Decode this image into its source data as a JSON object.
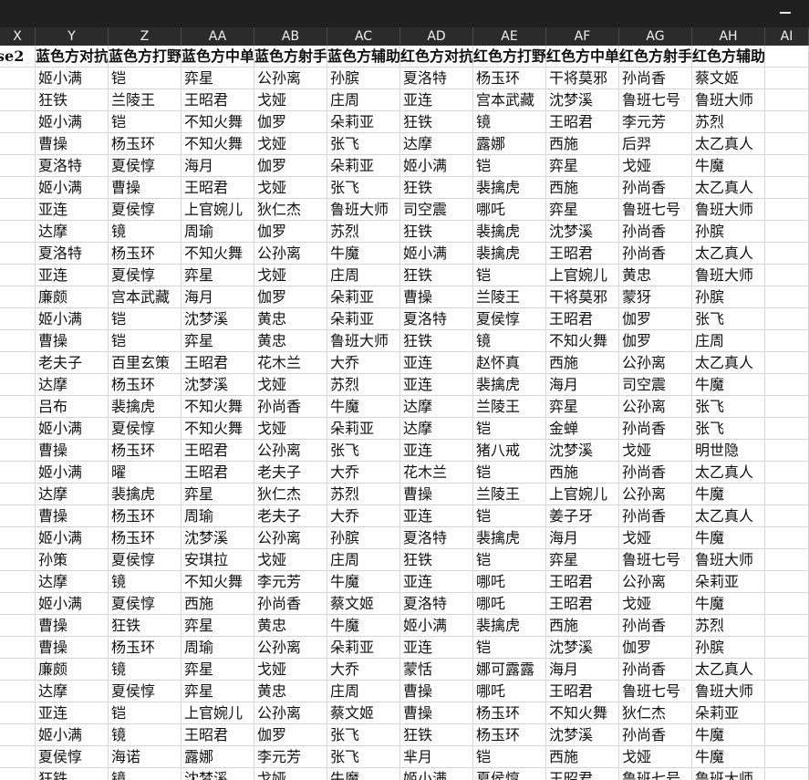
{
  "columns": [
    "X",
    "Y",
    "Z",
    "AA",
    "AB",
    "AC",
    "AD",
    "AE",
    "AF",
    "AG",
    "AH",
    "AI"
  ],
  "header": [
    "se2",
    "蓝色方对抗",
    "蓝色方打野",
    "蓝色方中单",
    "蓝色方射手",
    "蓝色方辅助",
    "红色方对抗",
    "红色方打野",
    "红色方中单",
    "红色方射手",
    "红色方辅助",
    ""
  ],
  "rows": [
    [
      "",
      "姬小满",
      "铠",
      "弈星",
      "公孙离",
      "孙膑",
      "夏洛特",
      "杨玉环",
      "干将莫邪",
      "孙尚香",
      "蔡文姬",
      ""
    ],
    [
      "",
      "狂铁",
      "兰陵王",
      "王昭君",
      "戈娅",
      "庄周",
      "亚连",
      "宫本武藏",
      "沈梦溪",
      "鲁班七号",
      "鲁班大师",
      ""
    ],
    [
      "",
      "姬小满",
      "铠",
      "不知火舞",
      "伽罗",
      "朵莉亚",
      "狂铁",
      "镜",
      "王昭君",
      "李元芳",
      "苏烈",
      ""
    ],
    [
      "",
      "曹操",
      "杨玉环",
      "不知火舞",
      "戈娅",
      "张飞",
      "达摩",
      "露娜",
      "西施",
      "后羿",
      "太乙真人",
      ""
    ],
    [
      "",
      "夏洛特",
      "夏侯惇",
      "海月",
      "伽罗",
      "朵莉亚",
      "姬小满",
      "铠",
      "弈星",
      "戈娅",
      "牛魔",
      ""
    ],
    [
      "",
      "姬小满",
      "曹操",
      "王昭君",
      "戈娅",
      "张飞",
      "狂铁",
      "裴擒虎",
      "西施",
      "孙尚香",
      "太乙真人",
      ""
    ],
    [
      "",
      "亚连",
      "夏侯惇",
      "上官婉儿",
      "狄仁杰",
      "鲁班大师",
      "司空震",
      "哪吒",
      "弈星",
      "鲁班七号",
      "鲁班大师",
      ""
    ],
    [
      "",
      "达摩",
      "镜",
      "周瑜",
      "伽罗",
      "苏烈",
      "狂铁",
      "裴擒虎",
      "沈梦溪",
      "孙尚香",
      "孙膑",
      ""
    ],
    [
      "",
      "夏洛特",
      "杨玉环",
      "不知火舞",
      "公孙离",
      "牛魔",
      "姬小满",
      "裴擒虎",
      "王昭君",
      "孙尚香",
      "太乙真人",
      ""
    ],
    [
      "",
      "亚连",
      "夏侯惇",
      "弈星",
      "戈娅",
      "庄周",
      "狂铁",
      "铠",
      "上官婉儿",
      "黄忠",
      "鲁班大师",
      ""
    ],
    [
      "",
      "廉颇",
      "宫本武藏",
      "海月",
      "伽罗",
      "朵莉亚",
      "曹操",
      "兰陵王",
      "干将莫邪",
      "蒙犽",
      "孙膑",
      ""
    ],
    [
      "",
      "姬小满",
      "铠",
      "沈梦溪",
      "黄忠",
      "朵莉亚",
      "夏洛特",
      "夏侯惇",
      "王昭君",
      "伽罗",
      "张飞",
      ""
    ],
    [
      "",
      "曹操",
      "铠",
      "弈星",
      "黄忠",
      "鲁班大师",
      "狂铁",
      "镜",
      "不知火舞",
      "伽罗",
      "庄周",
      ""
    ],
    [
      "",
      "老夫子",
      "百里玄策",
      "王昭君",
      "花木兰",
      "大乔",
      "亚连",
      "赵怀真",
      "西施",
      "公孙离",
      "太乙真人",
      ""
    ],
    [
      "",
      "达摩",
      "杨玉环",
      "沈梦溪",
      "戈娅",
      "苏烈",
      "亚连",
      "裴擒虎",
      "海月",
      "司空震",
      "牛魔",
      ""
    ],
    [
      "",
      "吕布",
      "裴擒虎",
      "不知火舞",
      "孙尚香",
      "牛魔",
      "达摩",
      "兰陵王",
      "弈星",
      "公孙离",
      "张飞",
      ""
    ],
    [
      "",
      "姬小满",
      "夏侯惇",
      "不知火舞",
      "戈娅",
      "朵莉亚",
      "达摩",
      "铠",
      "金蝉",
      "孙尚香",
      "张飞",
      ""
    ],
    [
      "",
      "曹操",
      "杨玉环",
      "王昭君",
      "公孙离",
      "张飞",
      "亚连",
      "猪八戒",
      "沈梦溪",
      "戈娅",
      "明世隐",
      ""
    ],
    [
      "",
      "姬小满",
      "曜",
      "王昭君",
      "老夫子",
      "大乔",
      "花木兰",
      "铠",
      "西施",
      "孙尚香",
      "太乙真人",
      ""
    ],
    [
      "",
      "达摩",
      "裴擒虎",
      "弈星",
      "狄仁杰",
      "苏烈",
      "曹操",
      "兰陵王",
      "上官婉儿",
      "公孙离",
      "牛魔",
      ""
    ],
    [
      "",
      "曹操",
      "杨玉环",
      "周瑜",
      "老夫子",
      "大乔",
      "亚连",
      "铠",
      "姜子牙",
      "孙尚香",
      "太乙真人",
      ""
    ],
    [
      "",
      "姬小满",
      "杨玉环",
      "沈梦溪",
      "公孙离",
      "孙膑",
      "夏洛特",
      "裴擒虎",
      "海月",
      "戈娅",
      "牛魔",
      ""
    ],
    [
      "",
      "孙策",
      "夏侯惇",
      "安琪拉",
      "戈娅",
      "庄周",
      "狂铁",
      "铠",
      "弈星",
      "鲁班七号",
      "鲁班大师",
      ""
    ],
    [
      "",
      "达摩",
      "镜",
      "不知火舞",
      "李元芳",
      "牛魔",
      "亚连",
      "哪吒",
      "王昭君",
      "公孙离",
      "朵莉亚",
      ""
    ],
    [
      "",
      "姬小满",
      "夏侯惇",
      "西施",
      "孙尚香",
      "蔡文姬",
      "夏洛特",
      "哪吒",
      "王昭君",
      "戈娅",
      "牛魔",
      ""
    ],
    [
      "",
      "曹操",
      "狂铁",
      "弈星",
      "黄忠",
      "牛魔",
      "姬小满",
      "裴擒虎",
      "西施",
      "孙尚香",
      "苏烈",
      ""
    ],
    [
      "",
      "曹操",
      "杨玉环",
      "周瑜",
      "公孙离",
      "朵莉亚",
      "亚连",
      "铠",
      "沈梦溪",
      "伽罗",
      "孙膑",
      ""
    ],
    [
      "",
      "廉颇",
      "镜",
      "弈星",
      "戈娅",
      "大乔",
      "蒙恬",
      "娜可露露",
      "海月",
      "孙尚香",
      "太乙真人",
      ""
    ],
    [
      "",
      "达摩",
      "夏侯惇",
      "弈星",
      "黄忠",
      "庄周",
      "曹操",
      "哪吒",
      "王昭君",
      "鲁班七号",
      "鲁班大师",
      ""
    ],
    [
      "",
      "亚连",
      "铠",
      "上官婉儿",
      "公孙离",
      "蔡文姬",
      "曹操",
      "杨玉环",
      "不知火舞",
      "狄仁杰",
      "朵莉亚",
      ""
    ],
    [
      "",
      "姬小满",
      "镜",
      "王昭君",
      "伽罗",
      "张飞",
      "狂铁",
      "杨玉环",
      "沈梦溪",
      "孙尚香",
      "牛魔",
      ""
    ],
    [
      "",
      "夏侯惇",
      "海诺",
      "露娜",
      "李元芳",
      "张飞",
      "芈月",
      "铠",
      "西施",
      "戈娅",
      "牛魔",
      ""
    ],
    [
      "",
      "狂铁",
      "镜",
      "沈梦溪",
      "戈娅",
      "牛魔",
      "姬小满",
      "夏侯惇",
      "王昭君",
      "鲁班七号",
      "鲁班大师",
      ""
    ]
  ]
}
